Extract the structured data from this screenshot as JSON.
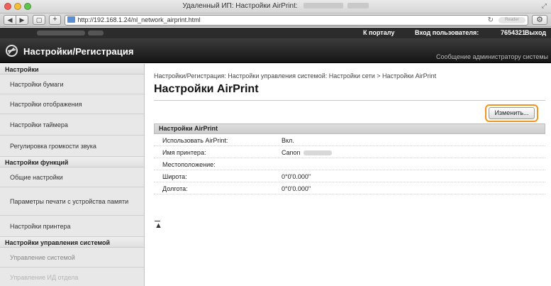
{
  "browser": {
    "window_title": "Удаленный ИП: Настройки AirPrint:",
    "url": "http://192.168.1.24/nl_network_airprint.html",
    "reload_icon": "reload-icon",
    "reader_label": "Reader",
    "buttons": [
      "back-icon",
      "forward-icon",
      "tabs-icon",
      "add-tab-icon",
      "settings-gear-icon"
    ]
  },
  "portal": {
    "portal_link": "К порталу",
    "login_label": "Вход пользователя:",
    "login_user": "7654321",
    "logout": "Выход"
  },
  "header": {
    "title": "Настройки/Регистрация",
    "admin_message": "Сообщение администратору системы"
  },
  "sidebar": {
    "sections": [
      {
        "title": "Настройки",
        "items": [
          "Настройки бумаги",
          "Настройки отображения",
          "Настройки таймера",
          "Регулировка громкости звука"
        ]
      },
      {
        "title": "Настройки функций",
        "items": [
          "Общие настройки",
          "Параметры печати с устройства памяти",
          "Настройки принтера"
        ]
      },
      {
        "title": "Настройки управления системой",
        "items": [
          "Управление системой",
          "Управление ИД отдела"
        ]
      }
    ]
  },
  "main": {
    "breadcrumb": "Настройки/Регистрация: Настройки управления системой: Настройки сети > Настройки AirPrint",
    "title": "Настройки AirPrint",
    "edit_button": "Изменить...",
    "panel_title": "Настройки AirPrint",
    "rows": [
      {
        "label": "Использовать AirPrint:",
        "value": "Вкл."
      },
      {
        "label": "Имя принтера:",
        "value": "Canon"
      },
      {
        "label": "Местоположение:",
        "value": ""
      },
      {
        "label": "Широта:",
        "value": "0°0'0.000\""
      },
      {
        "label": "Долгота:",
        "value": "0°0'0.000\""
      }
    ],
    "top_link": "▲"
  },
  "colors": {
    "highlight": "#f0951f",
    "header_bg": "#1f1f1f",
    "sidebar_bg": "#e4e4e4"
  }
}
